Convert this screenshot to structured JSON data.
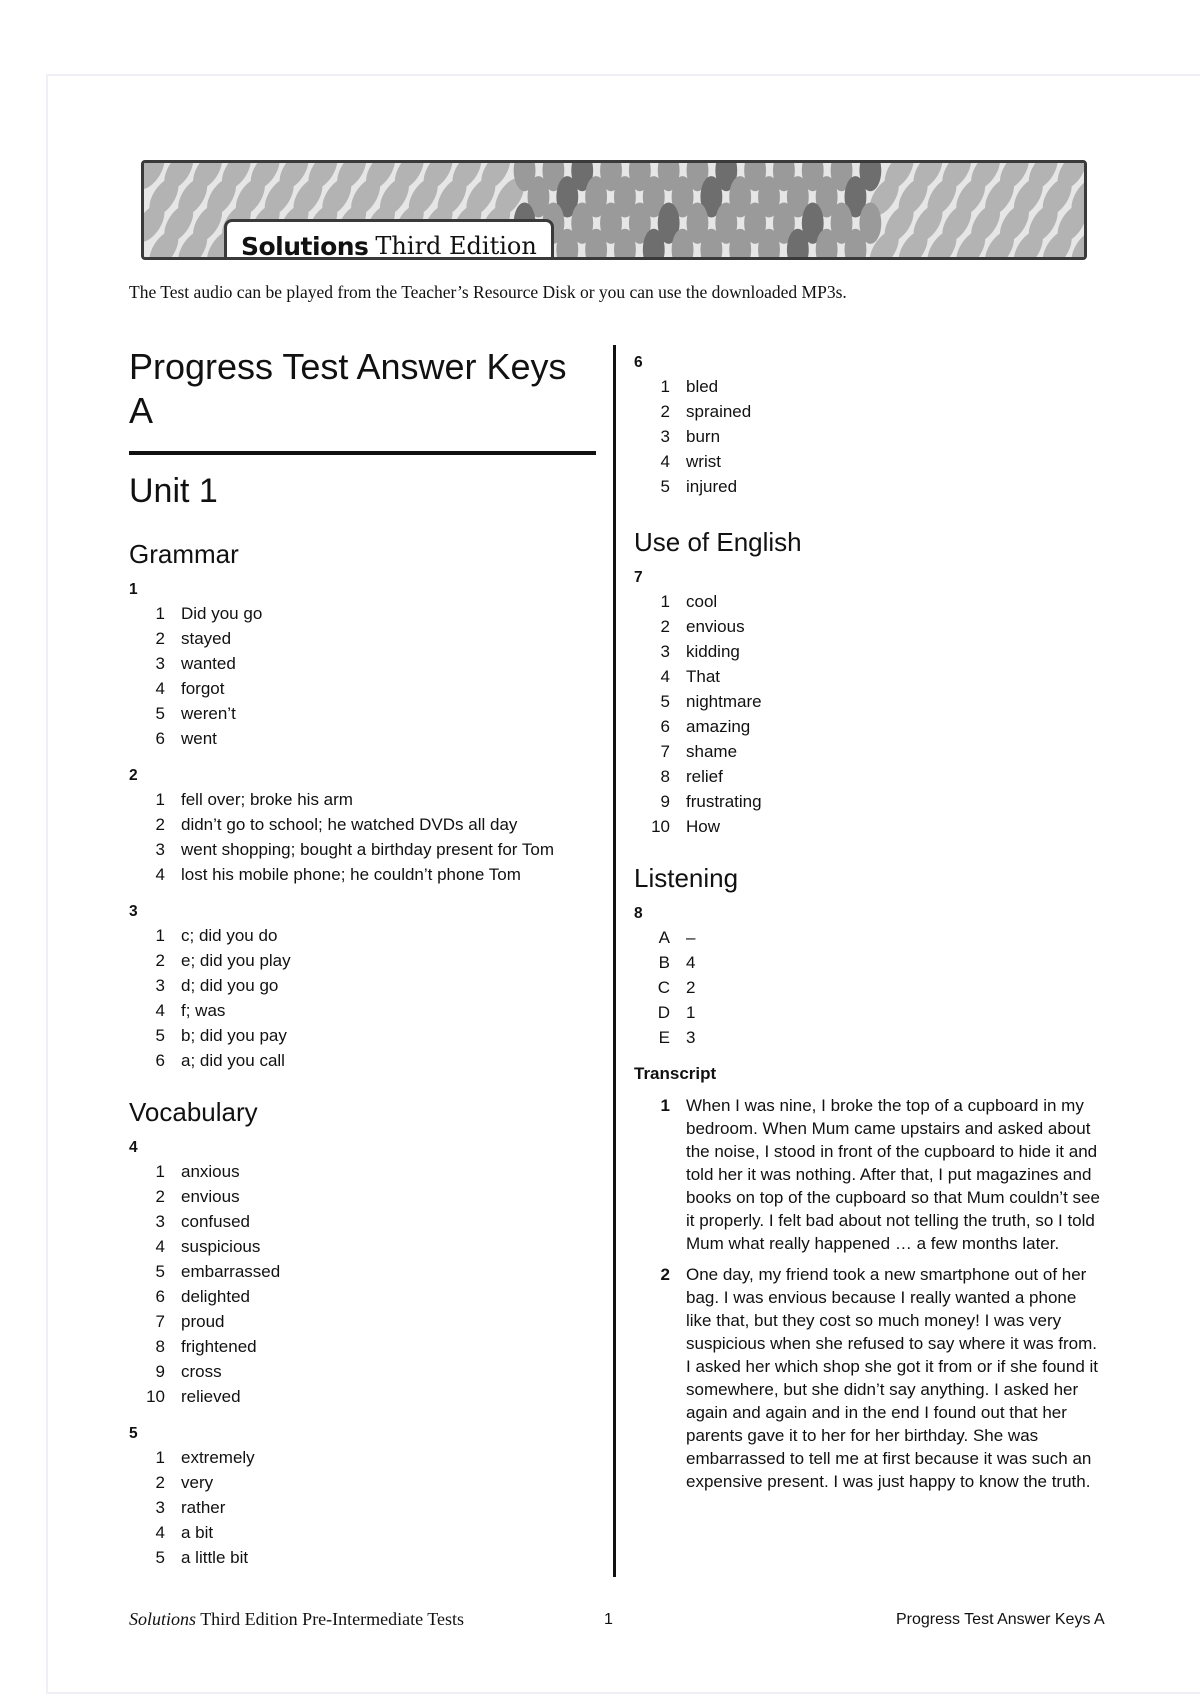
{
  "header": {
    "brand_bold": "Solutions",
    "brand_light": "Third Edition",
    "intro": "The Test audio can be played from the Teacher’s Resource Disk or you can use the downloaded MP3s."
  },
  "page_title": "Progress Test Answer Keys A",
  "unit_title": "Unit 1",
  "sections": {
    "grammar": {
      "title": "Grammar",
      "ex1": {
        "num": "1",
        "items": [
          {
            "n": "1",
            "t": "Did you go"
          },
          {
            "n": "2",
            "t": "stayed"
          },
          {
            "n": "3",
            "t": "wanted"
          },
          {
            "n": "4",
            "t": "forgot"
          },
          {
            "n": "5",
            "t": "weren’t"
          },
          {
            "n": "6",
            "t": "went"
          }
        ]
      },
      "ex2": {
        "num": "2",
        "items": [
          {
            "n": "1",
            "t": "fell over; broke his arm"
          },
          {
            "n": "2",
            "t": "didn’t go to school; he watched DVDs all day"
          },
          {
            "n": "3",
            "t": "went shopping; bought a birthday present for Tom"
          },
          {
            "n": "4",
            "t": "lost his mobile phone; he couldn’t phone Tom"
          }
        ]
      },
      "ex3": {
        "num": "3",
        "items": [
          {
            "n": "1",
            "t": "c; did you do"
          },
          {
            "n": "2",
            "t": "e; did you play"
          },
          {
            "n": "3",
            "t": "d; did you go"
          },
          {
            "n": "4",
            "t": "f; was"
          },
          {
            "n": "5",
            "t": "b; did you pay"
          },
          {
            "n": "6",
            "t": "a; did you call"
          }
        ]
      }
    },
    "vocabulary": {
      "title": "Vocabulary",
      "ex4": {
        "num": "4",
        "items": [
          {
            "n": "1",
            "t": "anxious"
          },
          {
            "n": "2",
            "t": "envious"
          },
          {
            "n": "3",
            "t": "confused"
          },
          {
            "n": "4",
            "t": "suspicious"
          },
          {
            "n": "5",
            "t": "embarrassed"
          },
          {
            "n": "6",
            "t": "delighted"
          },
          {
            "n": "7",
            "t": "proud"
          },
          {
            "n": "8",
            "t": "frightened"
          },
          {
            "n": "9",
            "t": "cross"
          },
          {
            "n": "10",
            "t": "relieved"
          }
        ]
      },
      "ex5": {
        "num": "5",
        "items": [
          {
            "n": "1",
            "t": "extremely"
          },
          {
            "n": "2",
            "t": "very"
          },
          {
            "n": "3",
            "t": "rather"
          },
          {
            "n": "4",
            "t": "a bit"
          },
          {
            "n": "5",
            "t": "a little bit"
          }
        ]
      },
      "ex6": {
        "num": "6",
        "items": [
          {
            "n": "1",
            "t": "bled"
          },
          {
            "n": "2",
            "t": "sprained"
          },
          {
            "n": "3",
            "t": "burn"
          },
          {
            "n": "4",
            "t": "wrist"
          },
          {
            "n": "5",
            "t": "injured"
          }
        ]
      }
    },
    "use_of_english": {
      "title": "Use of English",
      "ex7": {
        "num": "7",
        "items": [
          {
            "n": "1",
            "t": "cool"
          },
          {
            "n": "2",
            "t": "envious"
          },
          {
            "n": "3",
            "t": "kidding"
          },
          {
            "n": "4",
            "t": "That"
          },
          {
            "n": "5",
            "t": "nightmare"
          },
          {
            "n": "6",
            "t": "amazing"
          },
          {
            "n": "7",
            "t": "shame"
          },
          {
            "n": "8",
            "t": "relief"
          },
          {
            "n": "9",
            "t": "frustrating"
          },
          {
            "n": "10",
            "t": "How"
          }
        ]
      }
    },
    "listening": {
      "title": "Listening",
      "ex8": {
        "num": "8",
        "items": [
          {
            "n": "A",
            "t": "–"
          },
          {
            "n": "B",
            "t": "4"
          },
          {
            "n": "C",
            "t": "2"
          },
          {
            "n": "D",
            "t": "1"
          },
          {
            "n": "E",
            "t": "3"
          }
        ]
      },
      "transcript_label": "Transcript",
      "transcript": [
        {
          "n": "1",
          "t": "When I was nine, I broke the top of a cupboard in my bedroom. When Mum came upstairs and asked about the noise, I stood in front of the cupboard to hide it and told her it was nothing. After that, I put magazines and books on top of the cupboard so that Mum couldn’t see it properly. I felt bad about not telling the truth, so I told Mum what really happened … a few months later."
        },
        {
          "n": "2",
          "t": "One day, my friend took a new smartphone out of her bag. I was envious because I really wanted a phone like that, but they cost so much money! I was very suspicious when she refused to say where it was from. I asked her which shop she got it from or if she found it somewhere, but she didn’t say anything. I asked her again and again and in the end I found out that her parents gave it to her for her birthday. She was embarrassed to tell me at first because it was such an expensive present. I was just happy to know the truth."
        }
      ]
    }
  },
  "footer": {
    "left_italic": "Solutions",
    "left_rest": " Third Edition Pre-Intermediate Tests",
    "page_number": "1",
    "right": "Progress Test Answer Keys A"
  }
}
